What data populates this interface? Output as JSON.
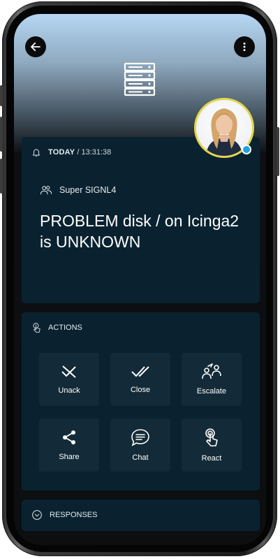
{
  "header": {
    "back_icon": "arrow-left-icon",
    "menu_icon": "more-vertical-icon",
    "category_icon": "server-icon"
  },
  "alert": {
    "bell_icon": "bell-icon",
    "date_label": "TODAY",
    "time": "/ 13:31:38",
    "team_icon": "team-icon",
    "team": "Super SIGNL4",
    "title": "PROBLEM disk / on Icinga2 is UNKNOWN"
  },
  "actions": {
    "heading": "ACTIONS",
    "heading_icon": "touch-icon",
    "items": [
      {
        "label": "Unack",
        "icon": "unack-icon"
      },
      {
        "label": "Close",
        "icon": "double-check-icon"
      },
      {
        "label": "Escalate",
        "icon": "escalate-icon"
      },
      {
        "label": "Share",
        "icon": "share-icon"
      },
      {
        "label": "Chat",
        "icon": "chat-icon"
      },
      {
        "label": "React",
        "icon": "tap-icon"
      }
    ]
  },
  "responses": {
    "heading": "RESPONSES",
    "heading_icon": "chevron-down-circle-icon"
  },
  "colors": {
    "card": "#0a2230",
    "tile": "#132b38",
    "accent": "#1fa2e0",
    "avatar_ring": "#e3d64a"
  }
}
